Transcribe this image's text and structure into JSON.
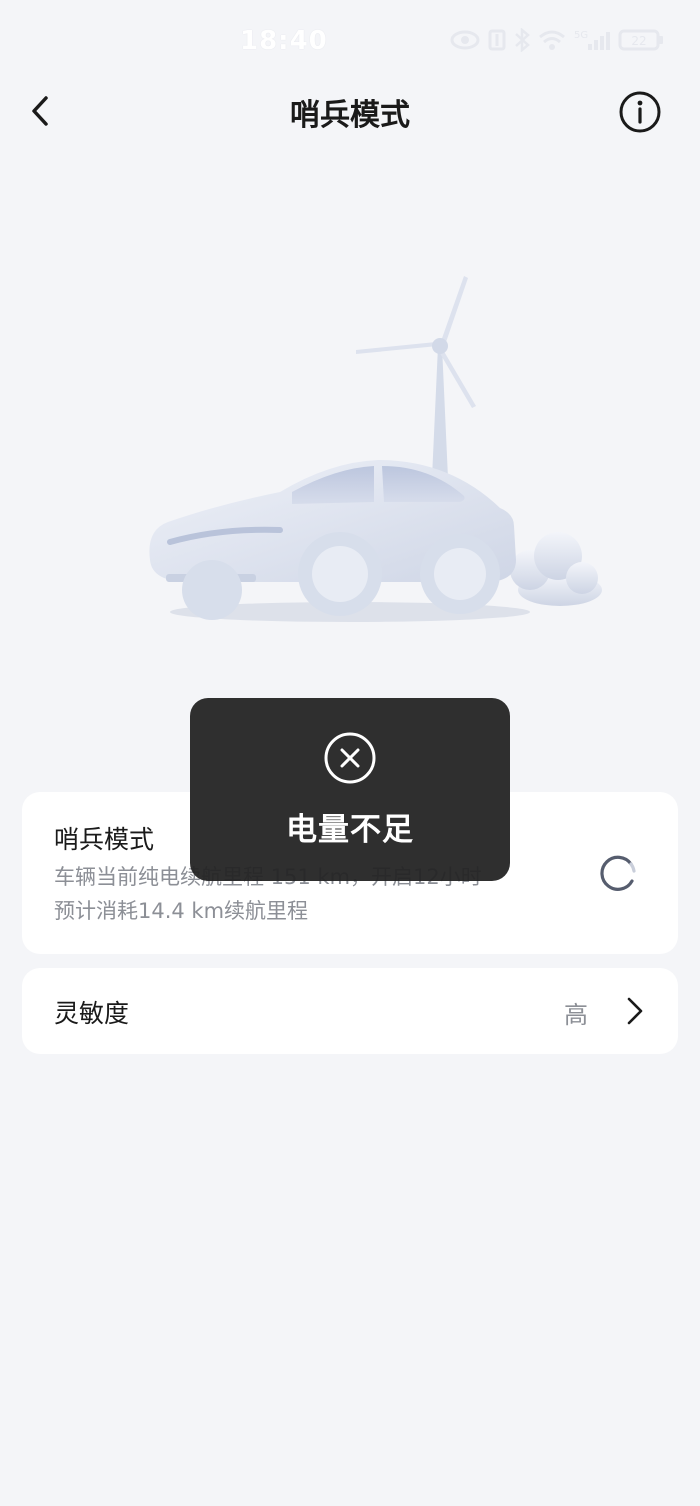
{
  "status_bar": {
    "time": "18:40",
    "battery": "22",
    "network": "5G",
    "icons": [
      "eye-icon",
      "nfc-icon",
      "bluetooth-icon",
      "wifi-icon",
      "signal-icon",
      "battery-icon"
    ]
  },
  "header": {
    "title": "哨兵模式",
    "back_icon": "chevron-left-icon",
    "info_icon": "info-icon"
  },
  "sentry_card": {
    "title": "哨兵模式",
    "description": "车辆当前纯电续航里程 151 km，开启12小时预计消耗14.4 km续航里程",
    "toggle_state": "loading"
  },
  "sensitivity_card": {
    "label": "灵敏度",
    "value": "高"
  },
  "toast": {
    "message": "电量不足",
    "icon": "close-circle-icon"
  },
  "colors": {
    "background": "#f4f5f8",
    "card": "#ffffff",
    "secondary_text": "#8c8f96",
    "toast_bg": "#242424"
  }
}
